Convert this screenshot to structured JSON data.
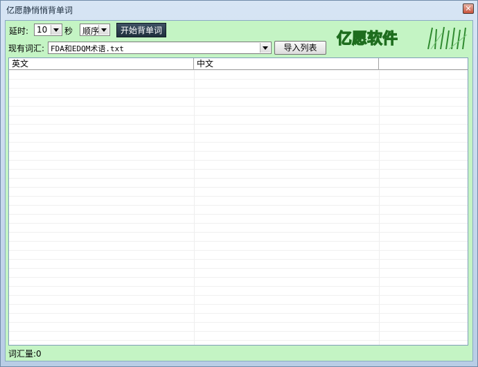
{
  "window": {
    "title": "亿愿静悄悄背单词",
    "close_label": "✕"
  },
  "toolbar": {
    "delay_label": "延时:",
    "delay_value": "10",
    "seconds_label": "秒",
    "order_value": "顺序",
    "start_button": "开始背单词",
    "vocab_label": "现有词汇:",
    "vocab_value": "FDA和EDQM术语.txt",
    "import_button": "导入列表"
  },
  "logo": {
    "text": "亿愿软件"
  },
  "table": {
    "columns": [
      "英文",
      "中文",
      ""
    ]
  },
  "status": {
    "word_count": "词汇量:0"
  }
}
